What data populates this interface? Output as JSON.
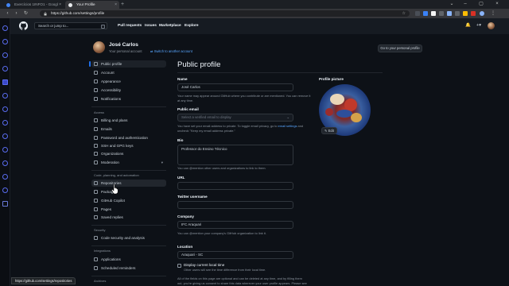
{
  "browser": {
    "tabs": [
      {
        "title": "Exercícios 1INFO1 - Googl",
        "active": false
      },
      {
        "title": "Your Profile",
        "active": true
      }
    ],
    "url": "https://github.com/settings/profile"
  },
  "header": {
    "search_placeholder": "Search or jump to...",
    "search_shortcut": "/",
    "nav": [
      "Pull requests",
      "Issues",
      "Marketplace",
      "Explore"
    ],
    "bell": "🔔",
    "plus": "+▾"
  },
  "user": {
    "name": "José Carlos",
    "subtitle": "Your personal account",
    "switch_link": "Switch to another account",
    "go_profile_button": "Go to your personal profile"
  },
  "sidebar": {
    "top_items": [
      {
        "label": "Public profile",
        "icon": "person-icon",
        "active": true
      },
      {
        "label": "Account",
        "icon": "gear-icon"
      },
      {
        "label": "Appearance",
        "icon": "paintbrush-icon"
      },
      {
        "label": "Accessibility",
        "icon": "accessibility-icon"
      },
      {
        "label": "Notifications",
        "icon": "bell-icon"
      }
    ],
    "access_title": "Access",
    "access_items": [
      {
        "label": "Billing and plans",
        "icon": "credit-card-icon"
      },
      {
        "label": "Emails",
        "icon": "mail-icon"
      },
      {
        "label": "Password and authentication",
        "icon": "shield-lock-icon"
      },
      {
        "label": "SSH and GPG keys",
        "icon": "key-icon"
      },
      {
        "label": "Organizations",
        "icon": "organization-icon"
      },
      {
        "label": "Moderation",
        "icon": "report-icon",
        "chevron": "▾"
      }
    ],
    "code_title": "Code, planning, and automation",
    "code_items": [
      {
        "label": "Repositories",
        "icon": "repo-icon",
        "hover": true
      },
      {
        "label": "Packages",
        "icon": "package-icon"
      },
      {
        "label": "GitHub Copilot",
        "icon": "copilot-icon"
      },
      {
        "label": "Pages",
        "icon": "browser-icon"
      },
      {
        "label": "Saved replies",
        "icon": "reply-icon"
      }
    ],
    "security_title": "Security",
    "security_items": [
      {
        "label": "Code security and analysis",
        "icon": "codescan-icon"
      }
    ],
    "integrations_title": "Integrations",
    "integrations_items": [
      {
        "label": "Applications",
        "icon": "apps-icon"
      },
      {
        "label": "Scheduled reminders",
        "icon": "clock-icon"
      }
    ],
    "archives_title": "Archives"
  },
  "profile": {
    "title": "Public profile",
    "name_label": "Name",
    "name_value": "José Carlos",
    "name_help": "Your name may appear around GitHub where you contribute or are mentioned. You can remove it at any time.",
    "email_label": "Public email",
    "email_placeholder": "Select a verified email to display",
    "email_caret": "⌄",
    "email_help_1": "You have set your email address to private. To toggle email privacy, go to ",
    "email_help_link": "email settings",
    "email_help_2": " and uncheck \"Keep my email address private.\"",
    "bio_label": "Bio",
    "bio_value": "Professor do Ensino Técnico",
    "bio_help": "You can @mention other users and organizations to link to them.",
    "url_label": "URL",
    "url_value": "",
    "twitter_label": "Twitter username",
    "twitter_value": "",
    "company_label": "Company",
    "company_value": "IFC Araquari",
    "company_help": "You can @mention your company's GitHub organization to link it.",
    "location_label": "Location",
    "location_value": "Araquari - SC",
    "local_time_label": "Display current local time",
    "local_time_help": "Other users will see the time difference from their local time.",
    "footer_help_1": "All of the fields on this page are optional and can be deleted at any time, and by filling them",
    "footer_help_2": "out, you're giving us consent to share this data wherever your user profile appears. Please see",
    "picture_label": "Profile picture",
    "edit_button": "✎ Edit"
  },
  "status_url": "https://github.com/settings/repositories",
  "colors": {
    "bg": "#0d1117",
    "header": "#161b22",
    "accent": "#1f6feb",
    "link": "#58a6ff"
  }
}
